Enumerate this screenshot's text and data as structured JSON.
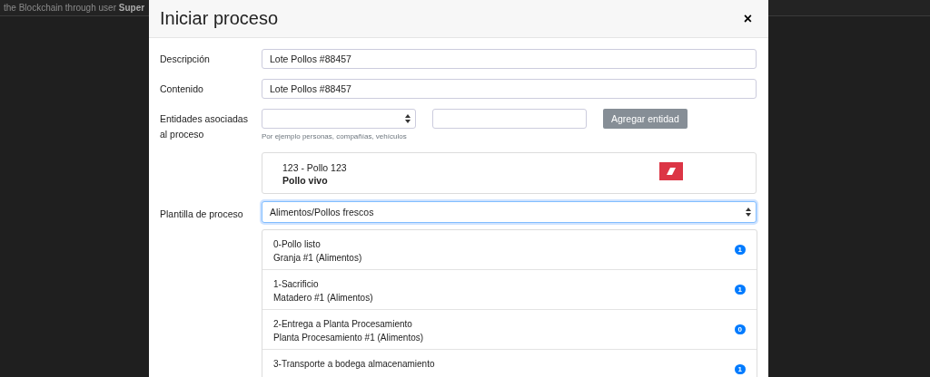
{
  "background": {
    "text": "the Blockchain through user **Super**"
  },
  "modal": {
    "title": "Iniciar proceso",
    "close": "×",
    "fields": [
      {
        "label": "Descripción",
        "value": "Lote Pollos #88457"
      },
      {
        "label": "Contenido",
        "value": "Lote Pollos #88457"
      }
    ],
    "entities": {
      "label": "Entidades asociadas al proceso",
      "hint": "Por ejemplo personas, compañías, vehículos",
      "button": "Agregar entidad",
      "items": [
        {
          "title": "123 - Pollo 123",
          "subtitle": "Pollo vivo"
        }
      ]
    },
    "template": {
      "label": "Plantilla de proceso",
      "value": "Alimentos/Pollos frescos"
    },
    "steps": [
      {
        "title": "0-Pollo listo",
        "subtitle": "Granja #1 (Alimentos)",
        "count": "1"
      },
      {
        "title": "1-Sacrificio",
        "subtitle": "Matadero #1 (Alimentos)",
        "count": "1"
      },
      {
        "title": "2-Entrega a Planta Procesamiento",
        "subtitle": "Planta Procesamiento #1 (Alimentos)",
        "count": "0"
      },
      {
        "title": "3-Transporte a bodega almacenamiento",
        "count": "1"
      }
    ]
  }
}
